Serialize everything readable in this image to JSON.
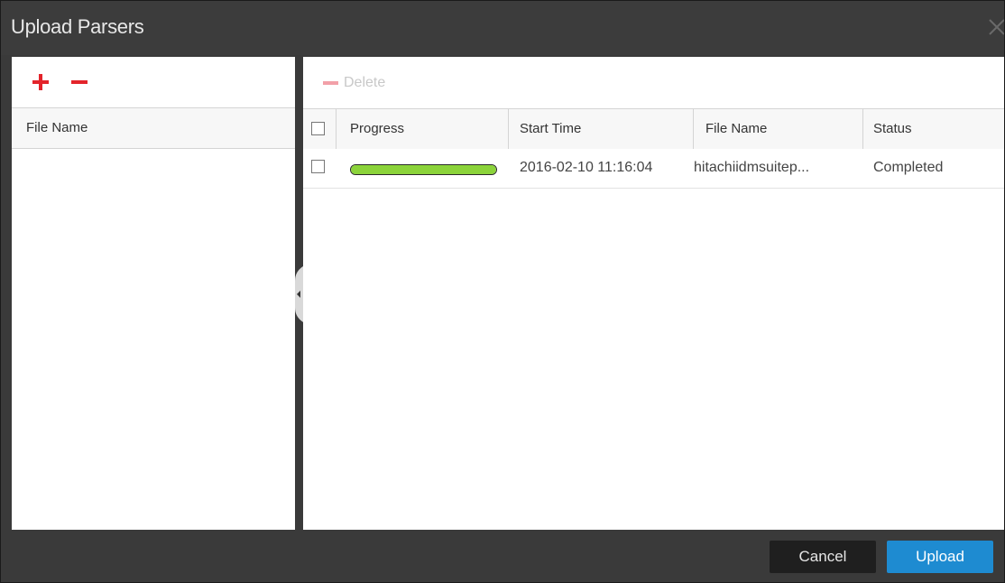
{
  "dialog": {
    "title": "Upload Parsers",
    "close_icon": "close-x-icon"
  },
  "left_panel": {
    "add_icon": "plus-icon",
    "remove_icon": "minus-icon",
    "column_header": "File Name",
    "colors": {
      "add": "#e3242b",
      "remove": "#e3242b"
    }
  },
  "right_panel": {
    "delete_label": "Delete",
    "delete_icon": "minus-icon",
    "columns": [
      "Progress",
      "Start Time",
      "File Name",
      "Status"
    ],
    "rows": [
      {
        "progress_percent": 100,
        "start_time": "2016-02-10 11:16:04",
        "file_name": "hitachiidmsuitep...",
        "status": "Completed"
      }
    ]
  },
  "footer": {
    "cancel_label": "Cancel",
    "upload_label": "Upload",
    "colors": {
      "upload": "#1e8bd1",
      "cancel": "#1f1f1f"
    }
  },
  "colors": {
    "chrome": "#3a3a3a",
    "progress_fill": "#8bd33a"
  }
}
